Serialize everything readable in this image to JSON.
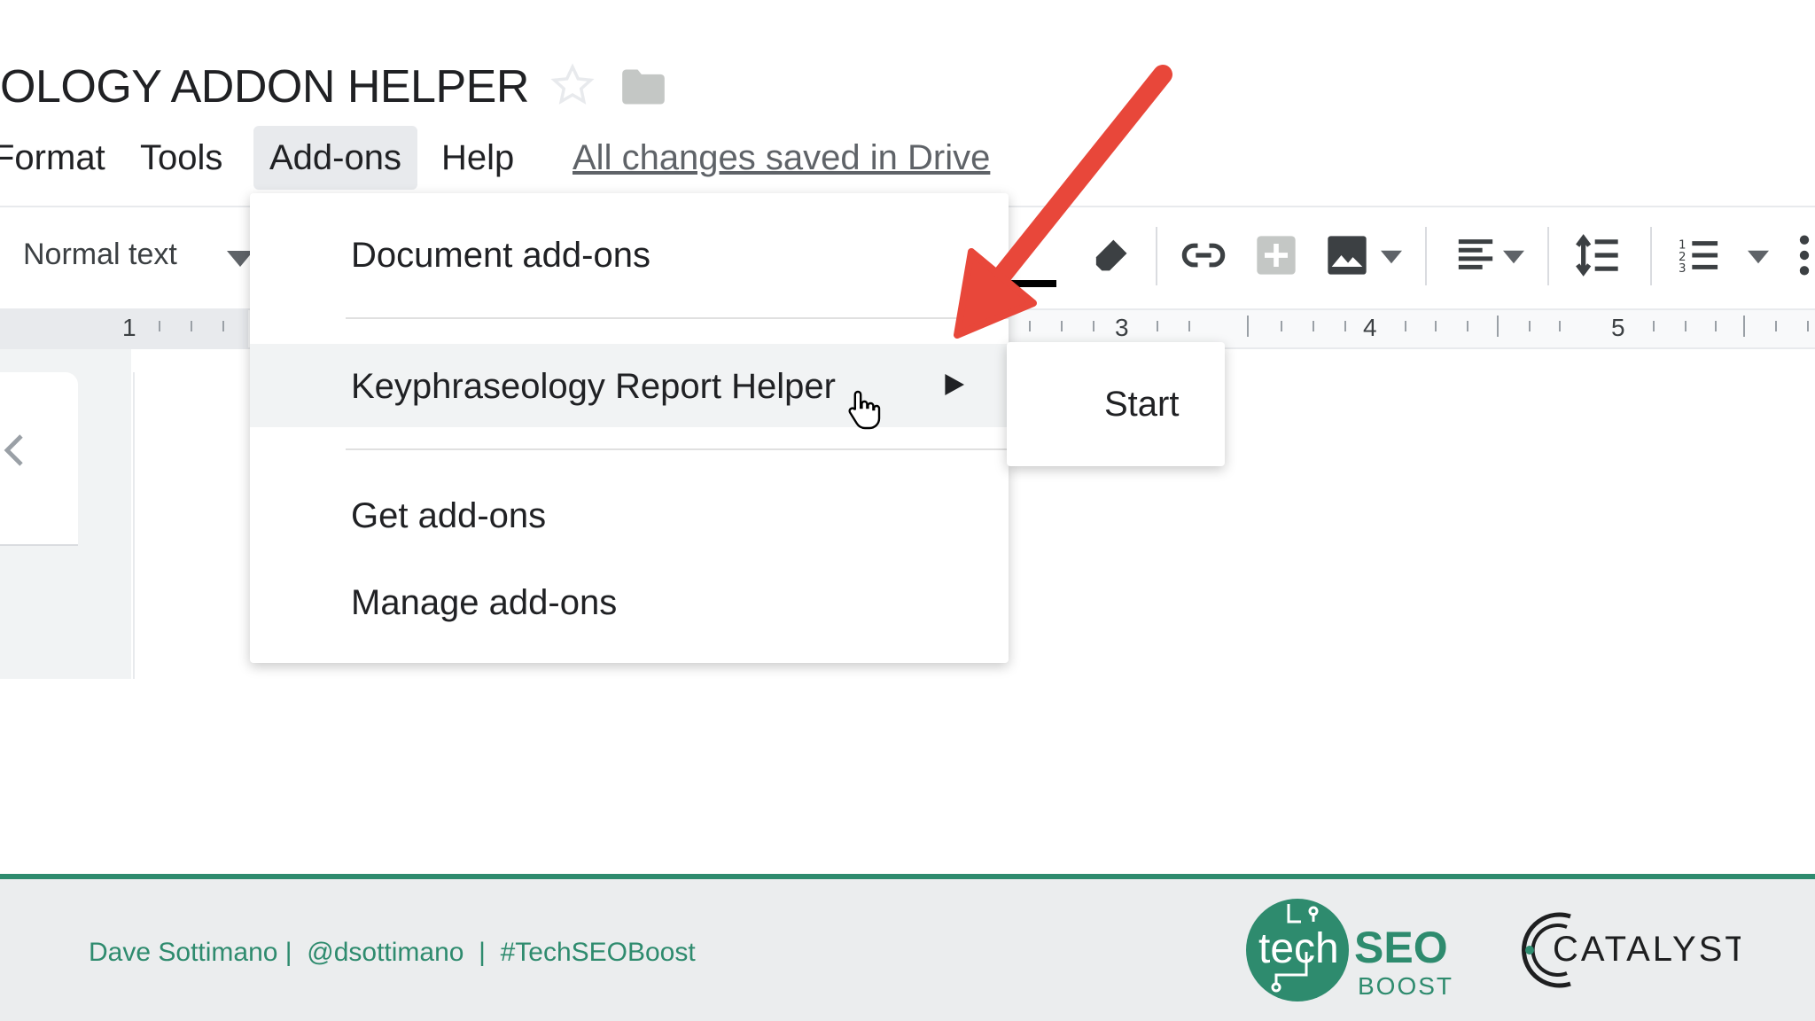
{
  "document": {
    "title": "OLOGY ADDON HELPER"
  },
  "menubar": {
    "format": "Format",
    "tools": "Tools",
    "addons": "Add-ons",
    "help": "Help",
    "save_status": "All changes saved in Drive"
  },
  "toolbar": {
    "style_select": "Normal text",
    "icons": [
      "highlighter-icon",
      "insert-link-icon",
      "insert-comment-icon",
      "insert-image-icon",
      "align-icon",
      "line-spacing-icon",
      "numbered-list-icon",
      "more-icon"
    ]
  },
  "ruler": {
    "numbers": [
      "1",
      "3",
      "4",
      "5"
    ]
  },
  "addons_menu": {
    "items": [
      {
        "label": "Document add-ons"
      },
      {
        "label": "Keyphraseology Report Helper",
        "has_submenu": true
      },
      {
        "label": "Get add-ons"
      },
      {
        "label": "Manage add-ons"
      }
    ]
  },
  "submenu": {
    "start": "Start"
  },
  "footer": {
    "text": "Dave Sottimano |  @dsottimano  |  #TechSEOBoost",
    "techseo_logo": {
      "tech": "tech",
      "seo": "SEO",
      "boost": "BOOST"
    },
    "catalyst_logo": "CATALYST",
    "colors": {
      "accent": "#2e8b6e"
    }
  },
  "colors": {
    "annotation_arrow": "#e8473a",
    "menu_highlight": "#f1f3f4"
  }
}
